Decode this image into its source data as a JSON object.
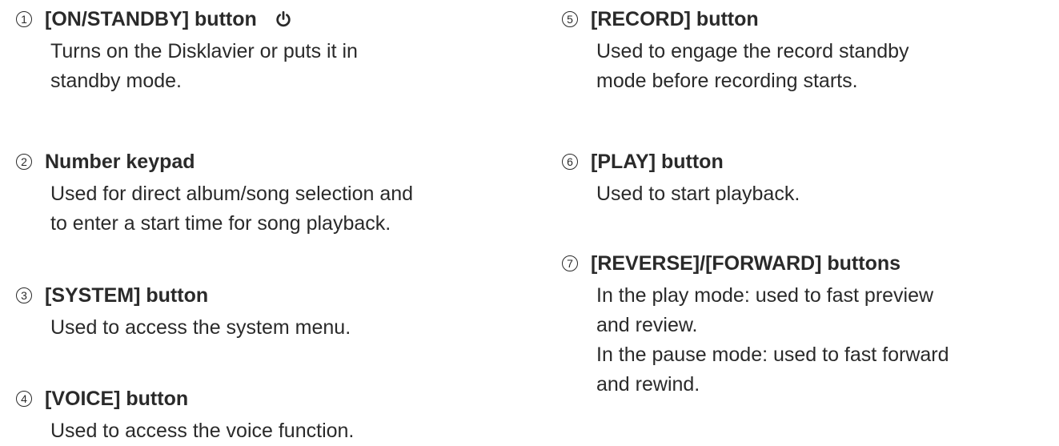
{
  "items": [
    {
      "number": "1",
      "title": "[ON/STANDBY] button",
      "icon": "power-icon",
      "lines": [
        "Turns on the Disklavier or puts it in",
        "standby mode."
      ]
    },
    {
      "number": "2",
      "title": "Number keypad",
      "lines": [
        "Used for direct album/song selection and",
        "to enter a start time for song playback."
      ]
    },
    {
      "number": "3",
      "title": "[SYSTEM] button",
      "lines": [
        "Used to access the system menu."
      ]
    },
    {
      "number": "4",
      "title": "[VOICE] button",
      "lines": [
        "Used to access the voice function."
      ]
    },
    {
      "number": "5",
      "title": "[RECORD] button",
      "lines": [
        "Used to engage the record standby",
        "mode before recording starts."
      ]
    },
    {
      "number": "6",
      "title": "[PLAY] button",
      "lines": [
        "Used to start playback."
      ]
    },
    {
      "number": "7",
      "title": "[REVERSE]/[FORWARD] buttons",
      "lines": [
        "In the play mode: used to fast preview",
        "and review.",
        "In the pause mode: used to fast forward",
        "and rewind."
      ]
    }
  ]
}
